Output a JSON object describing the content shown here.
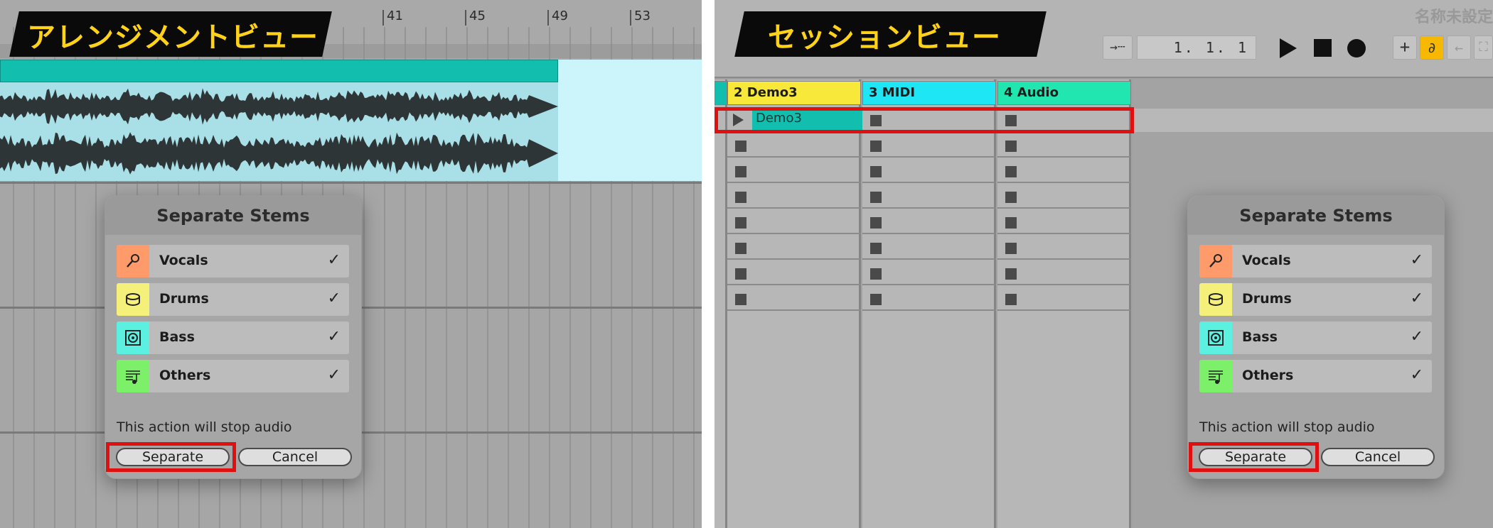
{
  "arrangement": {
    "title": "アレンジメントビュー",
    "bar_numbers": [
      "41",
      "45",
      "49",
      "53"
    ]
  },
  "session": {
    "title": "セッションビュー",
    "project_name": "名称未設定",
    "position": "1.  1.  1",
    "tracks": [
      {
        "name": "2 Demo3",
        "color": "#f8e83a"
      },
      {
        "name": "3 MIDI",
        "color": "#1ee6f5"
      },
      {
        "name": "4 Audio",
        "color": "#21e6b0"
      }
    ],
    "clip_name": "Demo3",
    "follow_icon": "arrow-follow-icon",
    "add_icon": "plus-icon",
    "link_icon": "link-icon",
    "back_icon": "arrow-left-icon",
    "expand_icon": "expand-icon"
  },
  "dialog": {
    "title": "Separate Stems",
    "stems": [
      {
        "label": "Vocals",
        "checked": "✓",
        "color": "#ff9a6a",
        "icon": "microphone-icon"
      },
      {
        "label": "Drums",
        "checked": "✓",
        "color": "#f5f07a",
        "icon": "drum-icon"
      },
      {
        "label": "Bass",
        "checked": "✓",
        "color": "#5cf0e0",
        "icon": "speaker-icon"
      },
      {
        "label": "Others",
        "checked": "✓",
        "color": "#7df06a",
        "icon": "score-icon"
      }
    ],
    "note": "This action will stop audio",
    "separate_label": "Separate",
    "cancel_label": "Cancel"
  },
  "highlight_color": "#e01010"
}
